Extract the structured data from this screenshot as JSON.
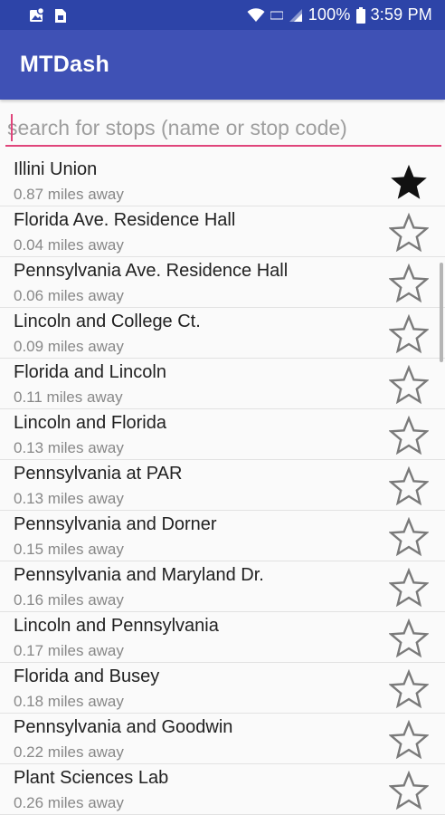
{
  "status_bar": {
    "battery_percent": "100%",
    "time": "3:59 PM"
  },
  "app_bar": {
    "title": "MTDash"
  },
  "search": {
    "value": "",
    "placeholder": "search for stops (name or stop code)"
  },
  "stops": [
    {
      "name": "Illini Union",
      "distance": "0.87 miles away",
      "favorite": true
    },
    {
      "name": "Florida Ave. Residence Hall",
      "distance": "0.04 miles away",
      "favorite": false
    },
    {
      "name": "Pennsylvania Ave. Residence Hall",
      "distance": "0.06 miles away",
      "favorite": false
    },
    {
      "name": "Lincoln and College Ct.",
      "distance": "0.09 miles away",
      "favorite": false
    },
    {
      "name": "Florida and Lincoln",
      "distance": "0.11 miles away",
      "favorite": false
    },
    {
      "name": "Lincoln and Florida",
      "distance": "0.13 miles away",
      "favorite": false
    },
    {
      "name": "Pennsylvania at PAR",
      "distance": "0.13 miles away",
      "favorite": false
    },
    {
      "name": "Pennsylvania and Dorner",
      "distance": "0.15 miles away",
      "favorite": false
    },
    {
      "name": "Pennsylvania and Maryland Dr.",
      "distance": "0.16 miles away",
      "favorite": false
    },
    {
      "name": "Lincoln and Pennsylvania",
      "distance": "0.17 miles away",
      "favorite": false
    },
    {
      "name": "Florida and Busey",
      "distance": "0.18 miles away",
      "favorite": false
    },
    {
      "name": "Pennsylvania and Goodwin",
      "distance": "0.22 miles away",
      "favorite": false
    },
    {
      "name": "Plant Sciences Lab",
      "distance": "0.26 miles away",
      "favorite": false
    }
  ],
  "colors": {
    "status_bar": "#2d44a8",
    "app_bar": "#3f51b5",
    "accent": "#e0457b"
  },
  "icons": {
    "favorite_on": "star-filled-icon",
    "favorite_off": "star-outline-icon"
  }
}
